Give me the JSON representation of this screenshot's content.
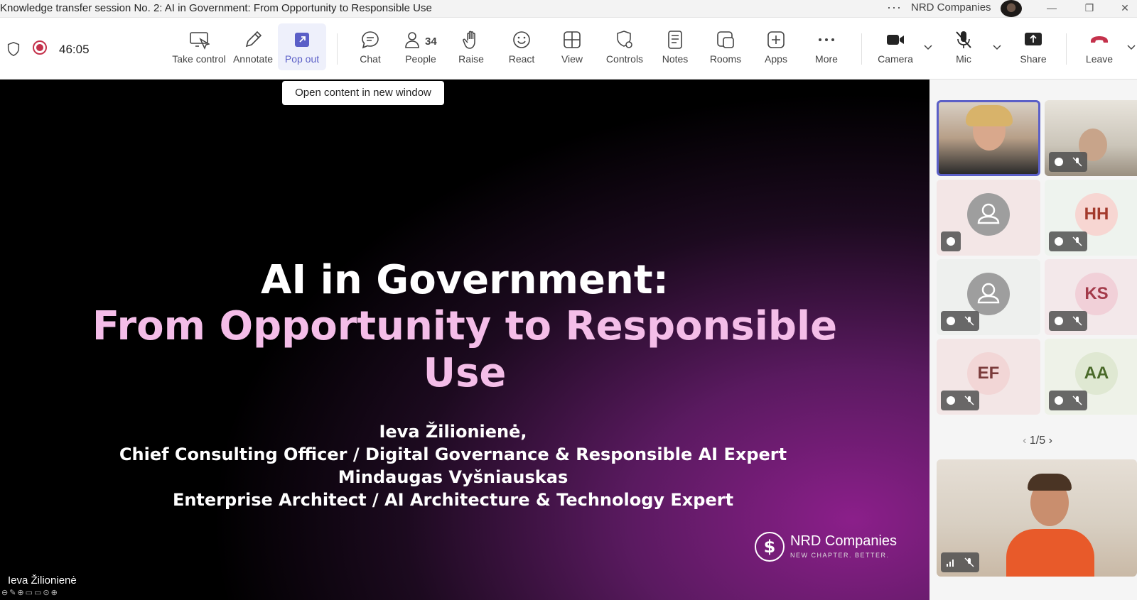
{
  "window": {
    "title": "Knowledge transfer session No. 2: AI in Government: From Opportunity to Responsible Use",
    "org": "NRD Companies",
    "more": "···",
    "minimize": "—",
    "restore": "❐",
    "close": "✕"
  },
  "meeting": {
    "timer": "46:05"
  },
  "toolbar": {
    "take_control": "Take control",
    "annotate": "Annotate",
    "pop_out": "Pop out",
    "chat": "Chat",
    "people": "People",
    "people_count": "34",
    "raise": "Raise",
    "react": "React",
    "view": "View",
    "controls": "Controls",
    "notes": "Notes",
    "rooms": "Rooms",
    "apps": "Apps",
    "more": "More",
    "camera": "Camera",
    "mic": "Mic",
    "share": "Share",
    "leave": "Leave"
  },
  "tooltip": "Open content in new window",
  "slide": {
    "title_line1": "AI in Government:",
    "title_line2": "From Opportunity to Responsible",
    "title_line3": "Use",
    "line1": "Ieva Žilionienė,",
    "line2": "Chief Consulting Officer / Digital Governance & Responsible AI Expert",
    "line3": "Mindaugas Vyšniauskas",
    "line4": "Enterprise Architect / AI Architecture & Technology Expert",
    "logo_name": "NRD Companies",
    "logo_tagline": "NEW CHAPTER. BETTER."
  },
  "presenter_name": "Ieva Žilionienė",
  "participants": [
    {
      "initials": ""
    },
    {
      "initials": ""
    },
    {
      "initials": ""
    },
    {
      "initials": "HH"
    },
    {
      "initials": ""
    },
    {
      "initials": "KS"
    },
    {
      "initials": "EF"
    },
    {
      "initials": "AA"
    }
  ],
  "pager": {
    "text": "1/5",
    "prev": "‹",
    "next": "›"
  },
  "colors": {
    "accent": "#5b5fc7",
    "leave": "#c4314b",
    "slide_pink": "#f4bde8"
  }
}
